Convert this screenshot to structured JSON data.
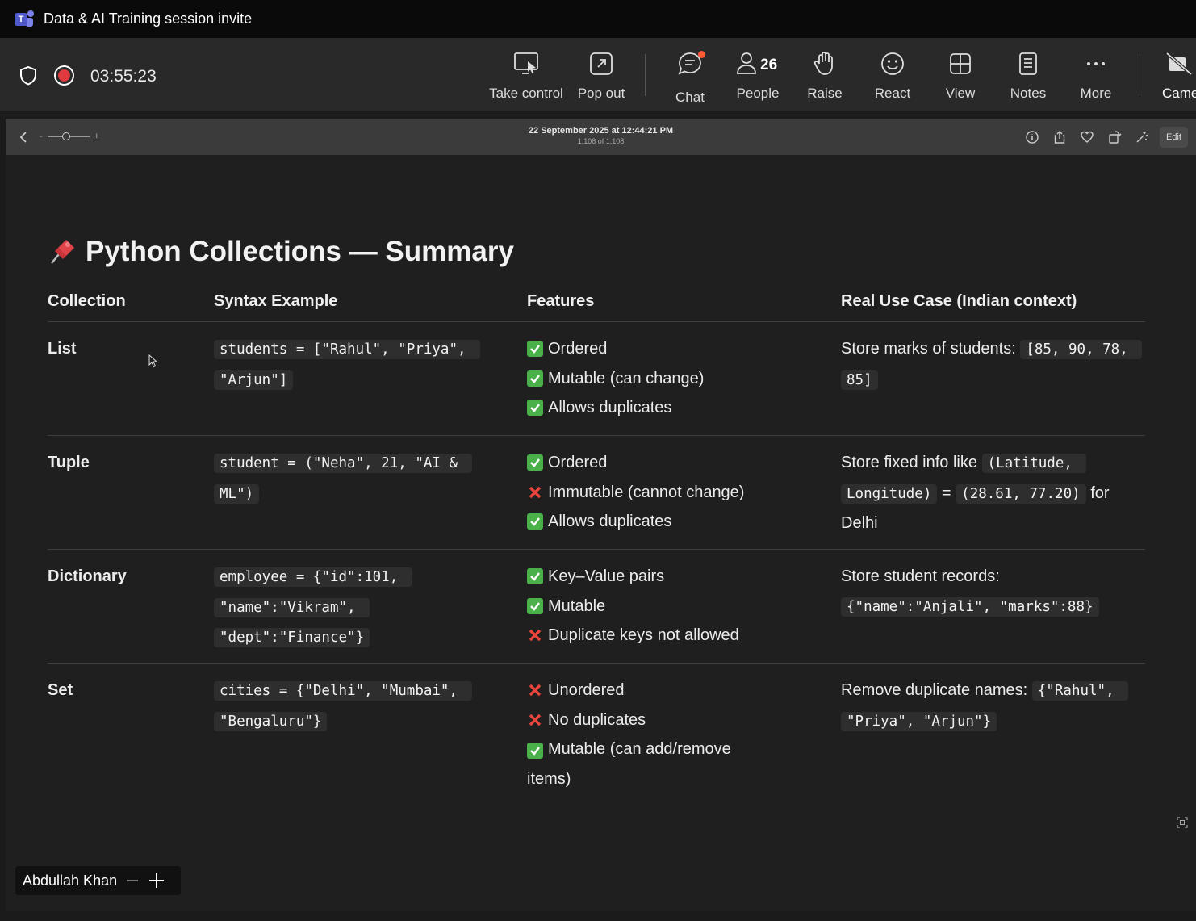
{
  "window": {
    "title": "Data & AI Training session invite"
  },
  "meeting": {
    "timer": "03:55:23",
    "buttons": [
      {
        "label": "Take control",
        "icon": "take-control-icon"
      },
      {
        "label": "Pop out",
        "icon": "pop-out-icon"
      },
      {
        "label": "Chat",
        "icon": "chat-icon"
      },
      {
        "label": "People",
        "icon": "people-icon"
      },
      {
        "label": "Raise",
        "icon": "raise-hand-icon"
      },
      {
        "label": "React",
        "icon": "react-icon"
      },
      {
        "label": "View",
        "icon": "view-icon"
      },
      {
        "label": "Notes",
        "icon": "notes-icon"
      },
      {
        "label": "More",
        "icon": "more-icon"
      },
      {
        "label": "Came",
        "icon": "camera-off-icon"
      }
    ],
    "people_count": "26"
  },
  "viewer": {
    "date": "22 September 2025 at 12:44:21 PM",
    "count": "1,108 of 1,108",
    "zoom_minus": "-",
    "zoom_plus": "+",
    "edit_label": "Edit"
  },
  "doc": {
    "title": "Python Collections — Summary",
    "headers": [
      "Collection",
      "Syntax Example",
      "Features",
      "Real Use Case (Indian context)"
    ],
    "rows": [
      {
        "name": "List",
        "syntax": "students = [\"Rahul\", \"Priya\", \"Arjun\"]",
        "features": [
          {
            "ok": true,
            "text": "Ordered"
          },
          {
            "ok": true,
            "text": "Mutable (can change)"
          },
          {
            "ok": true,
            "text": "Allows duplicates"
          }
        ],
        "usecase": {
          "text": "Store marks of students: ",
          "code": "[85, 90, 78, 85]"
        }
      },
      {
        "name": "Tuple",
        "syntax": "student = (\"Neha\", 21, \"AI & ML\")",
        "features": [
          {
            "ok": true,
            "text": "Ordered"
          },
          {
            "ok": false,
            "text": "Immutable (cannot change)"
          },
          {
            "ok": true,
            "text": "Allows duplicates"
          }
        ],
        "usecase": {
          "text": "Store fixed info like ",
          "code": "(Latitude, Longitude)",
          "mid": " = ",
          "code2": "(28.61, 77.20)",
          "tail": " for Delhi"
        }
      },
      {
        "name": "Dictionary",
        "syntax": "employee = {\"id\":101, \"name\":\"Vikram\", \"dept\":\"Finance\"}",
        "features": [
          {
            "ok": true,
            "text": "Key–Value pairs"
          },
          {
            "ok": true,
            "text": "Mutable"
          },
          {
            "ok": false,
            "text": "Duplicate keys not allowed"
          }
        ],
        "usecase": {
          "text": "Store student records: ",
          "code": "{\"name\":\"Anjali\", \"marks\":88}"
        }
      },
      {
        "name": "Set",
        "syntax": "cities = {\"Delhi\", \"Mumbai\", \"Bengaluru\"}",
        "features": [
          {
            "ok": false,
            "text": "Unordered"
          },
          {
            "ok": false,
            "text": "No duplicates"
          },
          {
            "ok": true,
            "text": "Mutable (can add/remove items)"
          }
        ],
        "usecase": {
          "text": "Remove duplicate names: ",
          "code": "{\"Rahul\", \"Priya\", \"Arjun\"}"
        }
      }
    ]
  },
  "presenter": {
    "name": "Abdullah Khan"
  }
}
